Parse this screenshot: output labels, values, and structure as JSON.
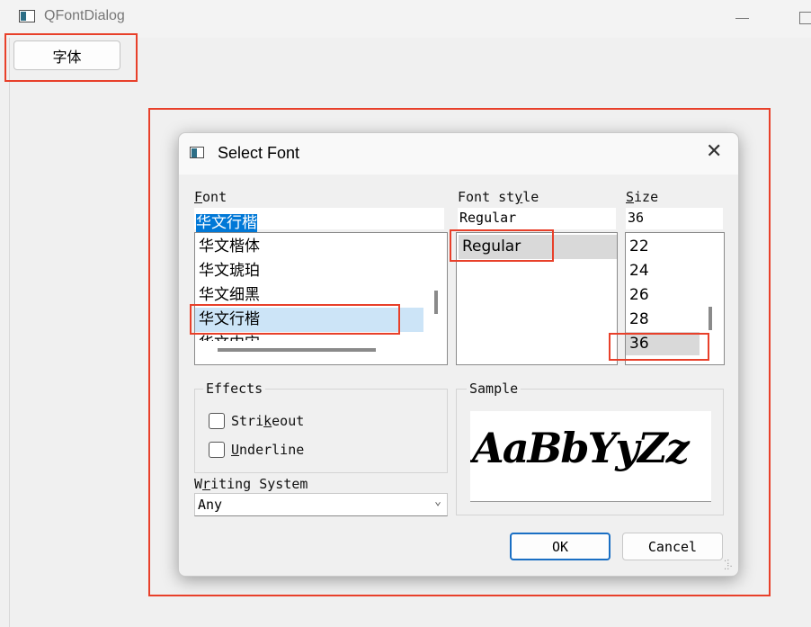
{
  "main_window": {
    "title": "QFontDialog",
    "font_button_label": "字体"
  },
  "dialog": {
    "title": "Select Font",
    "close_glyph": "✕",
    "font": {
      "label_mnemonic": "F",
      "label_rest": "ont",
      "value": "华文行楷",
      "items": [
        "华文楷体",
        "华文琥珀",
        "华文细黑",
        "华文行楷",
        "华文中宋"
      ],
      "selected": "华文行楷"
    },
    "font_style": {
      "label_pre": "Font st",
      "label_mnemonic": "y",
      "label_post": "le",
      "value": "Regular",
      "items": [
        "Regular"
      ],
      "selected": "Regular"
    },
    "size": {
      "label_mnemonic": "S",
      "label_rest": "ize",
      "value": "36",
      "items": [
        "22",
        "24",
        "26",
        "28",
        "36"
      ],
      "selected": "36"
    },
    "effects": {
      "title": "Effects",
      "strikeout_pre": "Stri",
      "strikeout_mnemonic": "k",
      "strikeout_post": "eout",
      "strikeout_checked": false,
      "underline_mnemonic": "U",
      "underline_rest": "nderline",
      "underline_checked": false
    },
    "writing_system": {
      "label_pre": "W",
      "label_mnemonic": "r",
      "label_post": "iting System",
      "value": "Any"
    },
    "sample": {
      "title": "Sample",
      "text": "AaBbYyZz"
    },
    "buttons": {
      "ok": "OK",
      "cancel": "Cancel"
    }
  },
  "colors": {
    "highlight_frame": "#e8402a",
    "selection_blue": "#cce4f7",
    "text_selection": "#0078d7",
    "default_button_border": "#1a6fc4"
  }
}
